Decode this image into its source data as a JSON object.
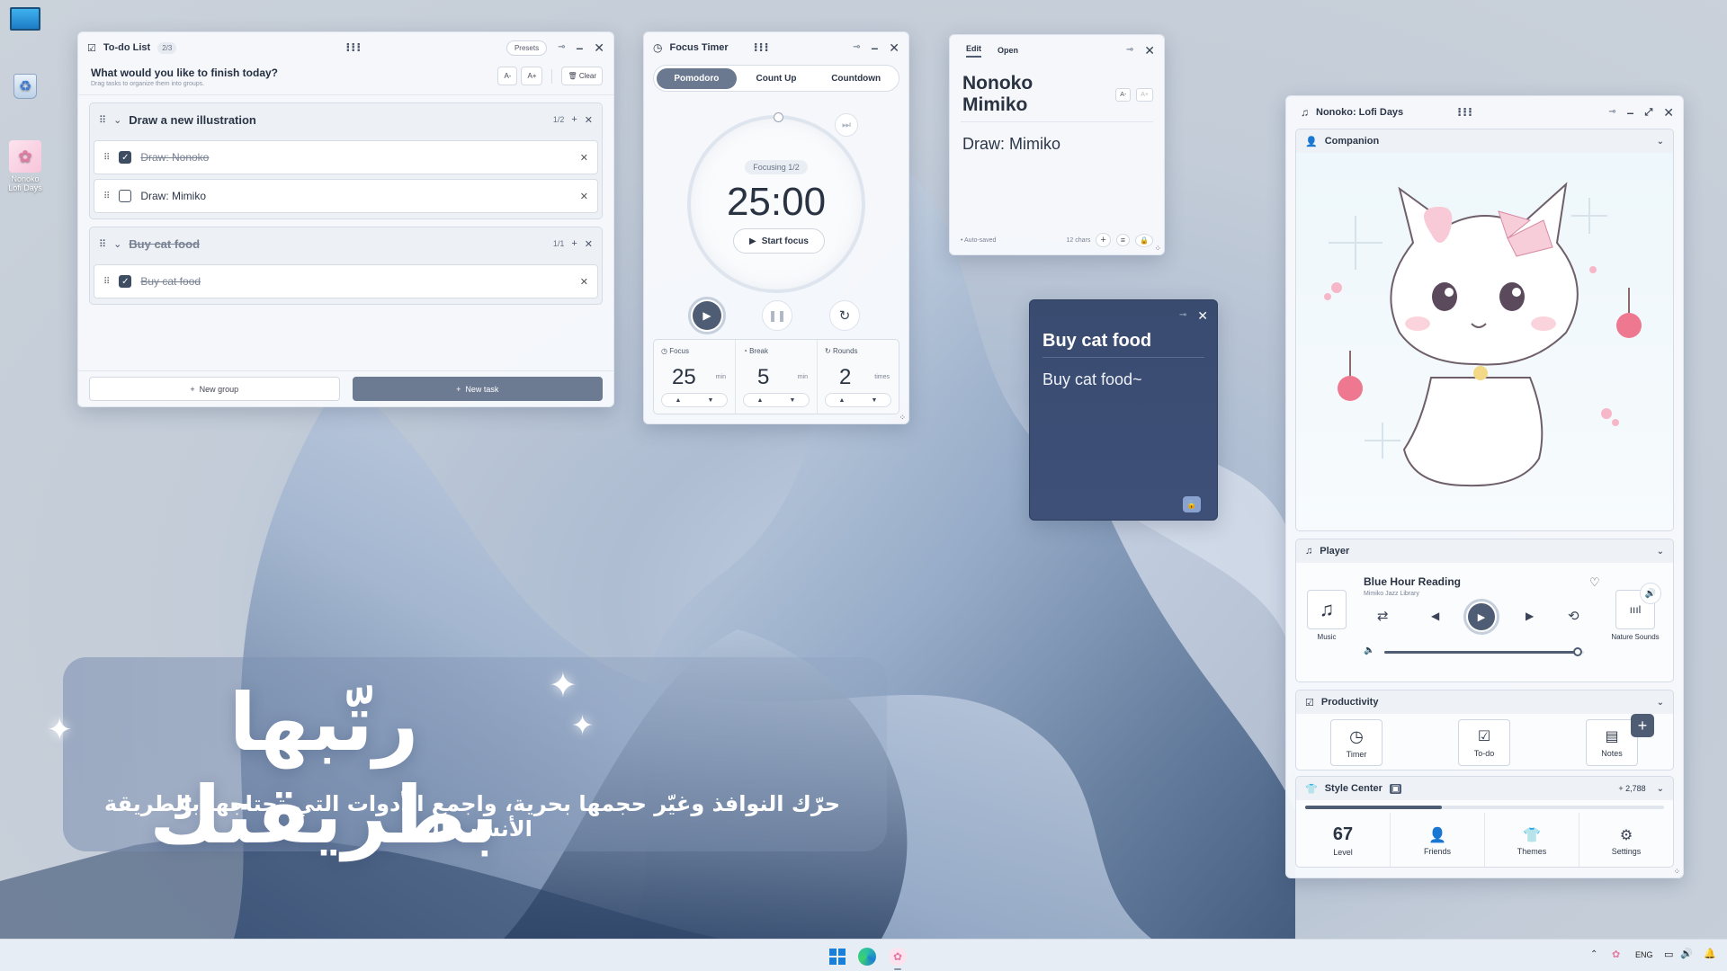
{
  "desktop": {
    "icons": [
      {
        "label": ""
      },
      {
        "label": ""
      },
      {
        "label": "Nonoko Lofi Days"
      }
    ]
  },
  "todo": {
    "title": "To-do List",
    "count_badge": "2/3",
    "presets_label": "Presets",
    "question": "What would you like to finish today?",
    "hint": "Drag tasks to organize them into groups.",
    "font_down": "A-",
    "font_up": "A+",
    "clear_label": "Clear",
    "groups": [
      {
        "name": "Draw a new illustration",
        "count": "1/2",
        "done": false,
        "tasks": [
          {
            "text": "Draw: Nonoko",
            "done": true
          },
          {
            "text": "Draw: Mimiko",
            "done": false
          }
        ]
      },
      {
        "name": "Buy cat food",
        "count": "1/1",
        "done": true,
        "tasks": [
          {
            "text": "Buy cat food",
            "done": true
          }
        ]
      }
    ],
    "new_group_label": "New group",
    "new_task_label": "New task"
  },
  "timer": {
    "title": "Focus Timer",
    "modes": [
      "Pomodoro",
      "Count Up",
      "Countdown"
    ],
    "active_mode": "Pomodoro",
    "focusing": "Focusing 1/2",
    "time": "25:00",
    "start_label": "Start focus",
    "stats": [
      {
        "label": "Focus",
        "value": "25",
        "unit": "min"
      },
      {
        "label": "Break",
        "value": "5",
        "unit": "min"
      },
      {
        "label": "Rounds",
        "value": "2",
        "unit": "times"
      }
    ]
  },
  "notes": {
    "tabs": [
      "Edit",
      "Open"
    ],
    "title": "Nonoko Mimiko",
    "font_down": "A-",
    "font_up": "A+",
    "body": "Draw: Mimiko",
    "autosaved": "Auto-saved",
    "chars": "12 chars"
  },
  "sticky": {
    "title": "Buy cat food",
    "body": "Buy cat food~"
  },
  "lofi": {
    "title": "Nonoko: Lofi Days",
    "companion_label": "Companion",
    "player_label": "Player",
    "track": "Blue Hour Reading",
    "artist": "Mimiko Jazz Library",
    "music_label": "Music",
    "nature_label": "Nature Sounds",
    "volume": 0.97,
    "productivity_label": "Productivity",
    "tools": [
      "Timer",
      "To-do",
      "Notes"
    ],
    "style_center_label": "Style Center",
    "coins": "+ 2,788",
    "level_progress": 0.38,
    "level_value": "67",
    "level_label": "Level",
    "menu": [
      "Friends",
      "Themes",
      "Settings"
    ]
  },
  "hero": {
    "title": "رتّبها بطريقتك",
    "subtitle": "حرّك النوافذ وغيّر حجمها بحرية، واجمع الأدوات التي تحتاجها بالطريقة الأنسب لك."
  },
  "taskbar": {
    "lang": "ENG"
  }
}
